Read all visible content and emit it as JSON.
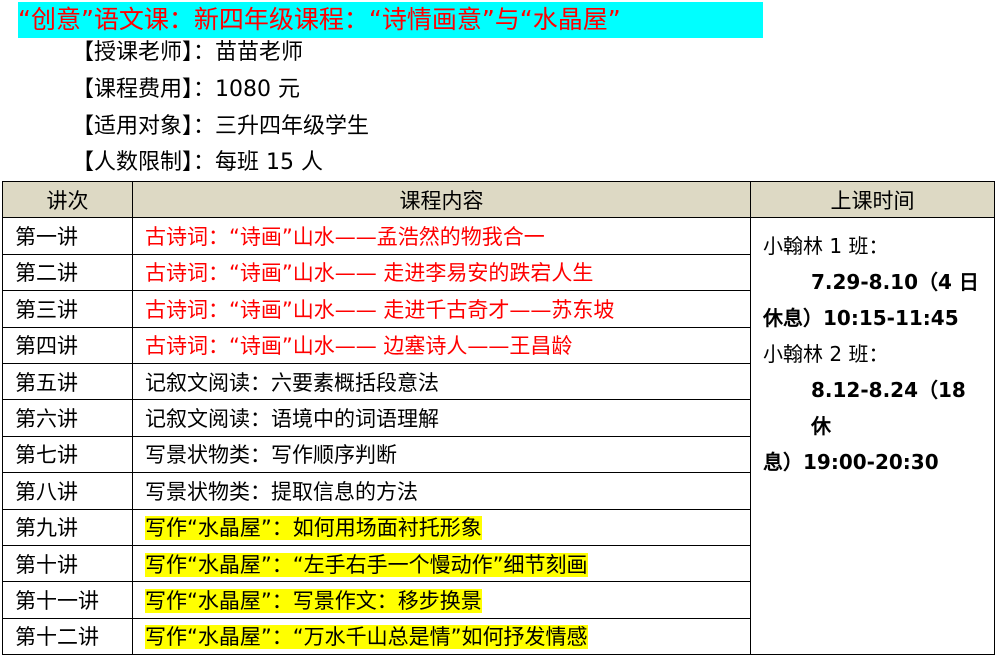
{
  "title": "“创意”语文课：新四年级课程：“诗情画意”与“水晶屋”",
  "info": [
    {
      "label": "【授课老师】：",
      "value": "苗苗老师"
    },
    {
      "label": "【课程费用】：",
      "value": "1080 元"
    },
    {
      "label": "【适用对象】：",
      "value": "三升四年级学生"
    },
    {
      "label": "【人数限制】：",
      "value": "每班 15 人"
    }
  ],
  "table": {
    "headers": [
      "讲次",
      "课程内容",
      "上课时间"
    ],
    "rows": [
      {
        "lesson": "第一讲",
        "content": "古诗词：“诗画”山水——孟浩然的物我合一",
        "style": "red"
      },
      {
        "lesson": "第二讲",
        "content": "古诗词：“诗画”山水—— 走进李易安的跌宕人生",
        "style": "red"
      },
      {
        "lesson": "第三讲",
        "content": "古诗词：“诗画”山水—— 走进千古奇才——苏东坡",
        "style": "red"
      },
      {
        "lesson": "第四讲",
        "content": "古诗词：“诗画”山水—— 边塞诗人——王昌龄",
        "style": "red"
      },
      {
        "lesson": "第五讲",
        "content": "记叙文阅读：六要素概括段意法",
        "style": "plain"
      },
      {
        "lesson": "第六讲",
        "content": "记叙文阅读：语境中的词语理解",
        "style": "plain"
      },
      {
        "lesson": "第七讲",
        "content": "写景状物类：写作顺序判断",
        "style": "plain"
      },
      {
        "lesson": "第八讲",
        "content": "写景状物类：提取信息的方法",
        "style": "plain"
      },
      {
        "lesson": "第九讲",
        "content": "写作“水晶屋”：如何用场面衬托形象",
        "style": "highlight"
      },
      {
        "lesson": "第十讲",
        "content": "写作“水晶屋”：“左手右手一个慢动作”细节刻画",
        "style": "highlight"
      },
      {
        "lesson": "第十一讲",
        "content": "写作“水晶屋”：写景作文：移步换景",
        "style": "highlight"
      },
      {
        "lesson": "第十二讲",
        "content": "写作“水晶屋”：“万水千山总是情”如何抒发情感",
        "style": "highlight"
      }
    ],
    "schedule": {
      "class1": "小翰林 1 班：",
      "class1_dates": "7.29-8.10（4 日",
      "class1_rest": "休息）10:15-11:45",
      "class2": "小翰林 2 班：",
      "class2_dates": "8.12-8.24（18 休",
      "class2_rest": "息）19:00-20:30"
    }
  }
}
